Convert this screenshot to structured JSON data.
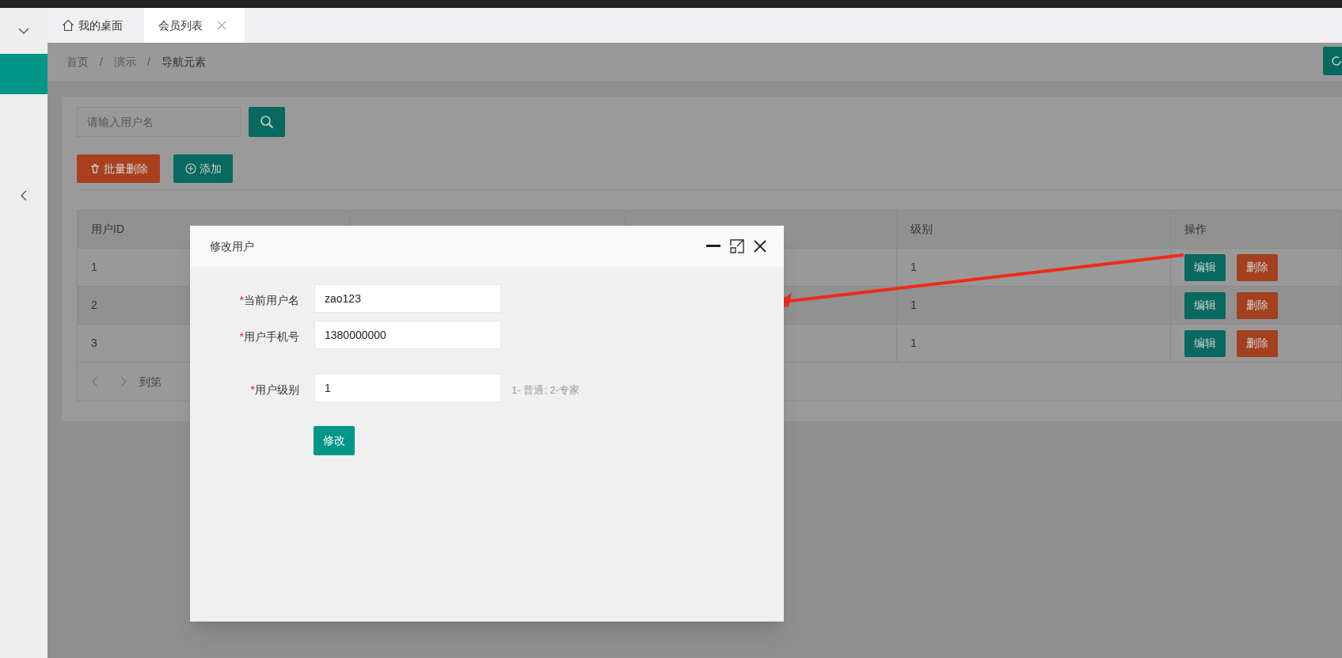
{
  "tabs": [
    {
      "label": "我的桌面",
      "selected": false,
      "closable": false
    },
    {
      "label": "会员列表",
      "selected": true,
      "closable": true
    }
  ],
  "breadcrumb": [
    {
      "kind": "link",
      "text": "首页"
    },
    {
      "kind": "separator",
      "text": "/"
    },
    {
      "kind": "link",
      "text": "演示"
    },
    {
      "kind": "separator",
      "text": "/"
    },
    {
      "kind": "current",
      "text": "导航元素"
    }
  ],
  "search": {
    "placeholder": "请输入用户名"
  },
  "toolbar": [
    {
      "label": "批量删除",
      "kind": "danger"
    },
    {
      "label": "添加",
      "kind": "primary"
    }
  ],
  "table": {
    "columns": [
      "用户ID",
      "级别",
      "操作"
    ],
    "rows": [
      {
        "id": "1",
        "grade": "1",
        "actions": [
          "编辑",
          "删除"
        ]
      },
      {
        "id": "2",
        "grade": "1",
        "actions": [
          "编辑",
          "删除"
        ]
      },
      {
        "id": "3",
        "grade": "1",
        "actions": [
          "编辑",
          "删除"
        ]
      }
    ],
    "pagination": {
      "goto_label": "到第"
    }
  },
  "dialog": {
    "title": "修改用户",
    "fields": [
      {
        "label": "当前用户名",
        "required": true,
        "mark": "*",
        "value": "zao123"
      },
      {
        "label": "用户手机号",
        "required": true,
        "mark": "*",
        "value": "1380000000"
      },
      {
        "label": "用户级别",
        "required": true,
        "mark": "*",
        "value": "1",
        "hint": "1- 普通; 2-专家"
      }
    ],
    "submit": "修改"
  }
}
